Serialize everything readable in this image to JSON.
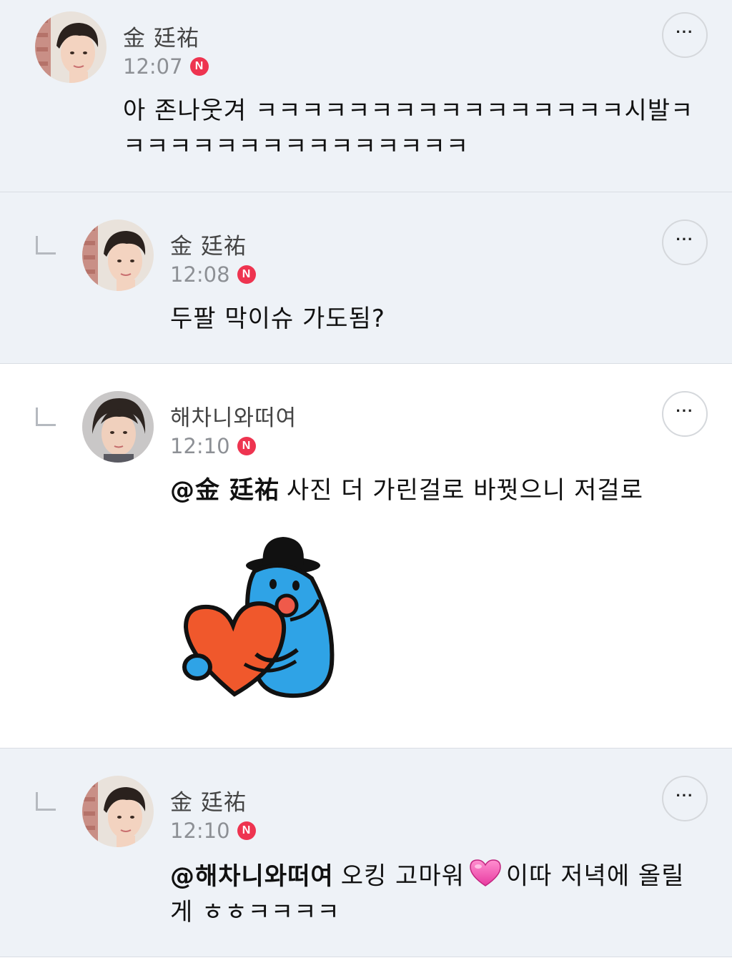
{
  "comments": [
    {
      "author": "金 廷祐",
      "time": "12:07",
      "badge": "N",
      "text": "아 존나웃겨 ㅋㅋㅋㅋㅋㅋㅋㅋㅋㅋㅋㅋㅋㅋㅋㅋ시발ㅋㅋㅋㅋㅋㅋㅋㅋㅋㅋㅋㅋㅋㅋㅋㅋ",
      "more_icon": "more-options-icon"
    },
    {
      "author": "金 廷祐",
      "time": "12:08",
      "badge": "N",
      "text": "두팔 막이슈 가도됨?",
      "more_icon": "more-options-icon"
    },
    {
      "author": "해차니와떠여",
      "time": "12:10",
      "badge": "N",
      "mention": "@金 廷祐",
      "text": "사진 더 가린걸로 바꿧으니 저걸로",
      "sticker": "blue-character-heart-sticker",
      "more_icon": "more-options-icon"
    },
    {
      "author": "金 廷祐",
      "time": "12:10",
      "badge": "N",
      "mention": "@해차니와떠여",
      "text_before_emoji": "오킹 고마워",
      "emoji": "pink-heart-emoji",
      "text_after_emoji": "이따 저녁에 올릴게 ㅎㅎㅋㅋㅋㅋ",
      "more_icon": "more-options-icon"
    }
  ],
  "more_label": "···",
  "colors": {
    "badge": "#ee3450",
    "comment_bg": "#eef2f7",
    "timestamp": "#8d9095"
  }
}
